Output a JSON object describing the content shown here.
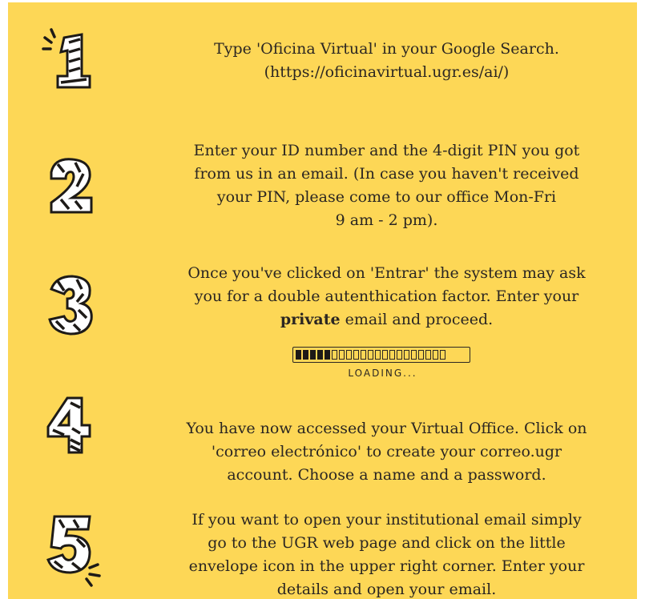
{
  "colors": {
    "background": "#fdd756",
    "text": "#2b2622",
    "number_fill": "#ffffff",
    "number_stripe": "#1d1a17"
  },
  "steps": [
    {
      "number": "1",
      "text": "Type 'Oficina Virtual' in your Google Search.",
      "text2": "(https://oficinavirtual.ugr.es/ai/)"
    },
    {
      "number": "2",
      "line1": "Enter your ID number and the 4-digit PIN you got",
      "line2": "from us in an email. (In case you haven't received",
      "line3": "your PIN, please come to our office Mon-Fri",
      "line4": "9 am - 2 pm)."
    },
    {
      "number": "3",
      "line1": "Once you've clicked on 'Entrar' the system may ask",
      "line2": "you for a double autenthication factor. Enter your",
      "bold": "private",
      "line3_rest": " email and proceed."
    },
    {
      "number": "4",
      "line1": "You have now accessed your Virtual Office. Click on",
      "line2": "'correo electrónico' to create your correo.ugr",
      "line3": "account. Choose a name and a password."
    },
    {
      "number": "5",
      "line1": "If you want to open your institutional email simply",
      "line2": "go to the UGR web page and click on the little",
      "line3": "envelope icon in the upper right corner. Enter your",
      "line4": "details and open your email."
    }
  ],
  "loading": {
    "label": "LOADING...",
    "progress": 0.29,
    "segments": 17
  }
}
